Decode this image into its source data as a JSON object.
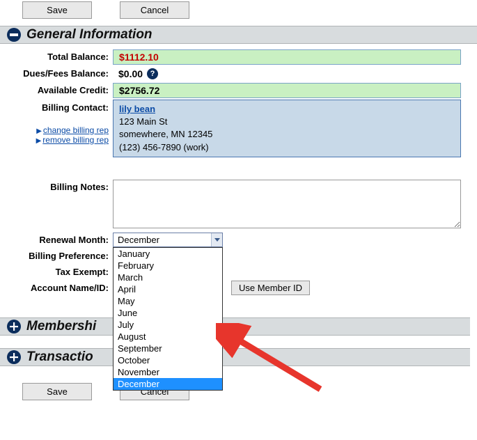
{
  "buttons": {
    "save": "Save",
    "cancel": "Cancel",
    "use_member_id": "Use Member ID"
  },
  "sections": {
    "general": "General Information",
    "memberships": "Membershi",
    "transactions": "Transactio"
  },
  "labels": {
    "total_balance": "Total Balance:",
    "dues_fees_balance": "Dues/Fees Balance:",
    "available_credit": "Available Credit:",
    "billing_contact": "Billing Contact:",
    "billing_notes": "Billing Notes:",
    "renewal_month": "Renewal Month:",
    "billing_preference": "Billing Preference:",
    "tax_exempt": "Tax Exempt:",
    "account_name_id": "Account Name/ID:"
  },
  "values": {
    "total_balance": "$1112.10",
    "dues_fees_balance": "$0.00",
    "available_credit": "$2756.72",
    "billing_notes": ""
  },
  "contact": {
    "name": "lily bean",
    "street": "123 Main St",
    "city_line": "somewhere, MN 12345",
    "phone": "(123) 456-7890 (work)"
  },
  "links": {
    "change_billing_rep": "change billing rep",
    "remove_billing_rep": "remove billing rep"
  },
  "renewal_month": {
    "selected": "December",
    "options": [
      "January",
      "February",
      "March",
      "April",
      "May",
      "June",
      "July",
      "August",
      "September",
      "October",
      "November",
      "December"
    ]
  }
}
